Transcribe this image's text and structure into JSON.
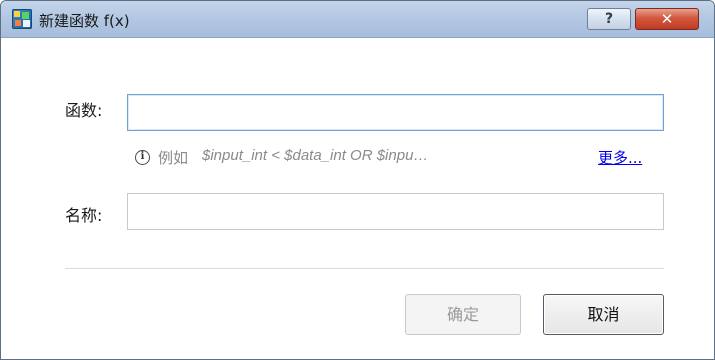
{
  "window": {
    "title": "新建函数 f(x)",
    "help_glyph": "?",
    "close_glyph": "✕"
  },
  "form": {
    "function_label": "函数:",
    "function_value": "",
    "hint_prefix": "例如",
    "hint_example": "$input_int < $data_int OR $inpu…",
    "more_link": "更多...",
    "name_label": "名称:",
    "name_value": ""
  },
  "buttons": {
    "ok": "确定",
    "cancel": "取消"
  },
  "colors": {
    "title_bar": "#b3c8e2",
    "close_button": "#c13b24",
    "link": "#0000ee",
    "focus_border": "#6fa3d6"
  }
}
